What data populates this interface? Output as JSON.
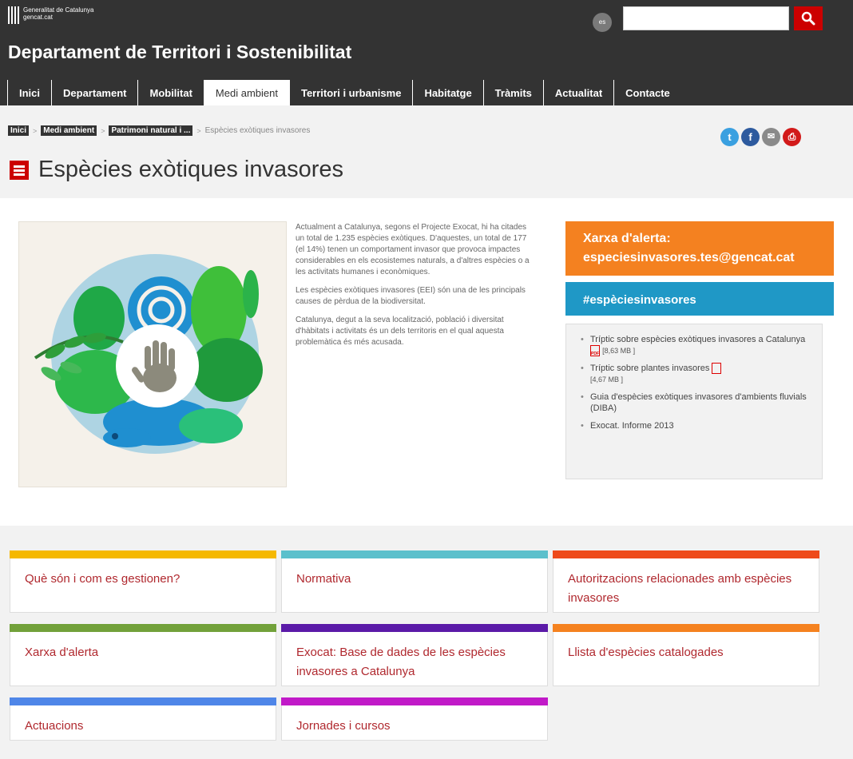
{
  "header": {
    "brand_line1": "Generalitat de Catalunya",
    "brand_line2": "gencat.cat",
    "lang": "es",
    "search_placeholder": "",
    "dept_title": "Departament de Territori i Sostenibilitat"
  },
  "nav": [
    {
      "label": "Inici",
      "active": false
    },
    {
      "label": "Departament",
      "active": false
    },
    {
      "label": "Mobilitat",
      "active": false
    },
    {
      "label": "Medi ambient",
      "active": true
    },
    {
      "label": "Territori i urbanisme",
      "active": false
    },
    {
      "label": "Habitatge",
      "active": false
    },
    {
      "label": "Tràmits",
      "active": false
    },
    {
      "label": "Actualitat",
      "active": false
    },
    {
      "label": "Contacte",
      "active": false
    }
  ],
  "breadcrumb": {
    "items": [
      "Inici",
      "Medi ambient",
      "Patrimoni natural i ..."
    ],
    "current": "Espècies exòtiques invasores"
  },
  "social": {
    "twitter": "t",
    "facebook": "f",
    "email": "✉",
    "print": "⎙"
  },
  "page_title": "Espècies exòtiques invasores",
  "intro": {
    "p1": "Actualment a Catalunya, segons el Projecte Exocat, hi ha citades un total de 1.235 espècies exòtiques. D'aquestes, un total de 177 (el 14%) tenen un comportament invasor que provoca impactes considerables en els ecosistemes naturals, a d'altres espècies o a les activitats humanes i econòmiques.",
    "p2": "Les espècies exòtiques invasores (EEI) són una de les principals causes de pèrdua de la biodiversitat.",
    "p3": "Catalunya, degut a la seva localització, població i diversitat d'hàbitats i activitats és un dels territoris en el qual aquesta problemàtica és més acusada."
  },
  "alert_box": {
    "line1": "Xarxa d'alerta:",
    "line2": "especiesinvasores.tes@gencat.cat"
  },
  "hashtag": "#espèciesinvasores",
  "docs": {
    "item1_text": "Tríptic sobre espècies exòtiques invasores a Catalunya",
    "item1_size": "[8,63 MB ]",
    "item2_text": "Tríptic sobre plantes invasores",
    "item2_size": "[4,67 MB ]",
    "item3_text": "Guia d'espècies exòtiques invasores d'ambients fluvials (DIBA)",
    "item4_text": "Exocat. Informe 2013",
    "pdf_label": "PDF"
  },
  "cards": [
    {
      "label": "Què són i com es gestionen?",
      "color": "#f5b800"
    },
    {
      "label": "Normativa",
      "color": "#5bc0cc"
    },
    {
      "label": "Autoritzacions relacionades amb espècies invasores",
      "color": "#ee4a1a"
    },
    {
      "label": "Xarxa d'alerta",
      "color": "#72a13a"
    },
    {
      "label": "Exocat: Base de dades de les espècies invasores a Catalunya",
      "color": "#5b1aa8"
    },
    {
      "label": "Llista d'espècies catalogades",
      "color": "#f5821f"
    },
    {
      "label": "Actuacions",
      "color": "#4f86e8"
    },
    {
      "label": "Jornades i cursos",
      "color": "#c11ac8"
    }
  ],
  "colors": {
    "header_bg": "#333333",
    "accent_red": "#cc0000",
    "alert_orange": "#f48120",
    "hashtag_blue": "#1f98c6",
    "link_red": "#b0282e"
  }
}
